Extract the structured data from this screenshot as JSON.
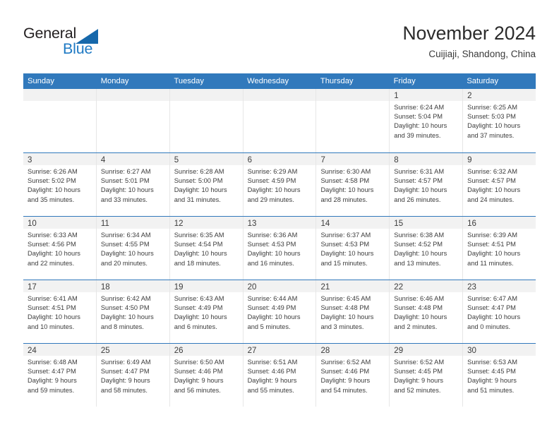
{
  "brand": {
    "name_part1": "General",
    "name_part2": "Blue",
    "triangle_icon": "blue-triangle-icon",
    "color_dark": "#231f20",
    "color_blue": "#1f7ac4"
  },
  "header": {
    "title": "November 2024",
    "subtitle": "Cuijiaji, Shandong, China"
  },
  "theme": {
    "header_row_bg": "#3179bc",
    "daynum_band_bg": "#f2f2f2",
    "grid_line": "#e6e6e6",
    "text": "#3c3c3c"
  },
  "weekdays": [
    "Sunday",
    "Monday",
    "Tuesday",
    "Wednesday",
    "Thursday",
    "Friday",
    "Saturday"
  ],
  "labels": {
    "sunrise": "Sunrise:",
    "sunset": "Sunset:",
    "daylight": "Daylight:"
  },
  "weeks": [
    [
      {
        "day": "",
        "sunrise": "",
        "sunset": "",
        "daylight_line1": "",
        "daylight_line2": ""
      },
      {
        "day": "",
        "sunrise": "",
        "sunset": "",
        "daylight_line1": "",
        "daylight_line2": ""
      },
      {
        "day": "",
        "sunrise": "",
        "sunset": "",
        "daylight_line1": "",
        "daylight_line2": ""
      },
      {
        "day": "",
        "sunrise": "",
        "sunset": "",
        "daylight_line1": "",
        "daylight_line2": ""
      },
      {
        "day": "",
        "sunrise": "",
        "sunset": "",
        "daylight_line1": "",
        "daylight_line2": ""
      },
      {
        "day": "1",
        "sunrise": "Sunrise: 6:24 AM",
        "sunset": "Sunset: 5:04 PM",
        "daylight_line1": "Daylight: 10 hours",
        "daylight_line2": "and 39 minutes."
      },
      {
        "day": "2",
        "sunrise": "Sunrise: 6:25 AM",
        "sunset": "Sunset: 5:03 PM",
        "daylight_line1": "Daylight: 10 hours",
        "daylight_line2": "and 37 minutes."
      }
    ],
    [
      {
        "day": "3",
        "sunrise": "Sunrise: 6:26 AM",
        "sunset": "Sunset: 5:02 PM",
        "daylight_line1": "Daylight: 10 hours",
        "daylight_line2": "and 35 minutes."
      },
      {
        "day": "4",
        "sunrise": "Sunrise: 6:27 AM",
        "sunset": "Sunset: 5:01 PM",
        "daylight_line1": "Daylight: 10 hours",
        "daylight_line2": "and 33 minutes."
      },
      {
        "day": "5",
        "sunrise": "Sunrise: 6:28 AM",
        "sunset": "Sunset: 5:00 PM",
        "daylight_line1": "Daylight: 10 hours",
        "daylight_line2": "and 31 minutes."
      },
      {
        "day": "6",
        "sunrise": "Sunrise: 6:29 AM",
        "sunset": "Sunset: 4:59 PM",
        "daylight_line1": "Daylight: 10 hours",
        "daylight_line2": "and 29 minutes."
      },
      {
        "day": "7",
        "sunrise": "Sunrise: 6:30 AM",
        "sunset": "Sunset: 4:58 PM",
        "daylight_line1": "Daylight: 10 hours",
        "daylight_line2": "and 28 minutes."
      },
      {
        "day": "8",
        "sunrise": "Sunrise: 6:31 AM",
        "sunset": "Sunset: 4:57 PM",
        "daylight_line1": "Daylight: 10 hours",
        "daylight_line2": "and 26 minutes."
      },
      {
        "day": "9",
        "sunrise": "Sunrise: 6:32 AM",
        "sunset": "Sunset: 4:57 PM",
        "daylight_line1": "Daylight: 10 hours",
        "daylight_line2": "and 24 minutes."
      }
    ],
    [
      {
        "day": "10",
        "sunrise": "Sunrise: 6:33 AM",
        "sunset": "Sunset: 4:56 PM",
        "daylight_line1": "Daylight: 10 hours",
        "daylight_line2": "and 22 minutes."
      },
      {
        "day": "11",
        "sunrise": "Sunrise: 6:34 AM",
        "sunset": "Sunset: 4:55 PM",
        "daylight_line1": "Daylight: 10 hours",
        "daylight_line2": "and 20 minutes."
      },
      {
        "day": "12",
        "sunrise": "Sunrise: 6:35 AM",
        "sunset": "Sunset: 4:54 PM",
        "daylight_line1": "Daylight: 10 hours",
        "daylight_line2": "and 18 minutes."
      },
      {
        "day": "13",
        "sunrise": "Sunrise: 6:36 AM",
        "sunset": "Sunset: 4:53 PM",
        "daylight_line1": "Daylight: 10 hours",
        "daylight_line2": "and 16 minutes."
      },
      {
        "day": "14",
        "sunrise": "Sunrise: 6:37 AM",
        "sunset": "Sunset: 4:53 PM",
        "daylight_line1": "Daylight: 10 hours",
        "daylight_line2": "and 15 minutes."
      },
      {
        "day": "15",
        "sunrise": "Sunrise: 6:38 AM",
        "sunset": "Sunset: 4:52 PM",
        "daylight_line1": "Daylight: 10 hours",
        "daylight_line2": "and 13 minutes."
      },
      {
        "day": "16",
        "sunrise": "Sunrise: 6:39 AM",
        "sunset": "Sunset: 4:51 PM",
        "daylight_line1": "Daylight: 10 hours",
        "daylight_line2": "and 11 minutes."
      }
    ],
    [
      {
        "day": "17",
        "sunrise": "Sunrise: 6:41 AM",
        "sunset": "Sunset: 4:51 PM",
        "daylight_line1": "Daylight: 10 hours",
        "daylight_line2": "and 10 minutes."
      },
      {
        "day": "18",
        "sunrise": "Sunrise: 6:42 AM",
        "sunset": "Sunset: 4:50 PM",
        "daylight_line1": "Daylight: 10 hours",
        "daylight_line2": "and 8 minutes."
      },
      {
        "day": "19",
        "sunrise": "Sunrise: 6:43 AM",
        "sunset": "Sunset: 4:49 PM",
        "daylight_line1": "Daylight: 10 hours",
        "daylight_line2": "and 6 minutes."
      },
      {
        "day": "20",
        "sunrise": "Sunrise: 6:44 AM",
        "sunset": "Sunset: 4:49 PM",
        "daylight_line1": "Daylight: 10 hours",
        "daylight_line2": "and 5 minutes."
      },
      {
        "day": "21",
        "sunrise": "Sunrise: 6:45 AM",
        "sunset": "Sunset: 4:48 PM",
        "daylight_line1": "Daylight: 10 hours",
        "daylight_line2": "and 3 minutes."
      },
      {
        "day": "22",
        "sunrise": "Sunrise: 6:46 AM",
        "sunset": "Sunset: 4:48 PM",
        "daylight_line1": "Daylight: 10 hours",
        "daylight_line2": "and 2 minutes."
      },
      {
        "day": "23",
        "sunrise": "Sunrise: 6:47 AM",
        "sunset": "Sunset: 4:47 PM",
        "daylight_line1": "Daylight: 10 hours",
        "daylight_line2": "and 0 minutes."
      }
    ],
    [
      {
        "day": "24",
        "sunrise": "Sunrise: 6:48 AM",
        "sunset": "Sunset: 4:47 PM",
        "daylight_line1": "Daylight: 9 hours",
        "daylight_line2": "and 59 minutes."
      },
      {
        "day": "25",
        "sunrise": "Sunrise: 6:49 AM",
        "sunset": "Sunset: 4:47 PM",
        "daylight_line1": "Daylight: 9 hours",
        "daylight_line2": "and 58 minutes."
      },
      {
        "day": "26",
        "sunrise": "Sunrise: 6:50 AM",
        "sunset": "Sunset: 4:46 PM",
        "daylight_line1": "Daylight: 9 hours",
        "daylight_line2": "and 56 minutes."
      },
      {
        "day": "27",
        "sunrise": "Sunrise: 6:51 AM",
        "sunset": "Sunset: 4:46 PM",
        "daylight_line1": "Daylight: 9 hours",
        "daylight_line2": "and 55 minutes."
      },
      {
        "day": "28",
        "sunrise": "Sunrise: 6:52 AM",
        "sunset": "Sunset: 4:46 PM",
        "daylight_line1": "Daylight: 9 hours",
        "daylight_line2": "and 54 minutes."
      },
      {
        "day": "29",
        "sunrise": "Sunrise: 6:52 AM",
        "sunset": "Sunset: 4:45 PM",
        "daylight_line1": "Daylight: 9 hours",
        "daylight_line2": "and 52 minutes."
      },
      {
        "day": "30",
        "sunrise": "Sunrise: 6:53 AM",
        "sunset": "Sunset: 4:45 PM",
        "daylight_line1": "Daylight: 9 hours",
        "daylight_line2": "and 51 minutes."
      }
    ]
  ]
}
